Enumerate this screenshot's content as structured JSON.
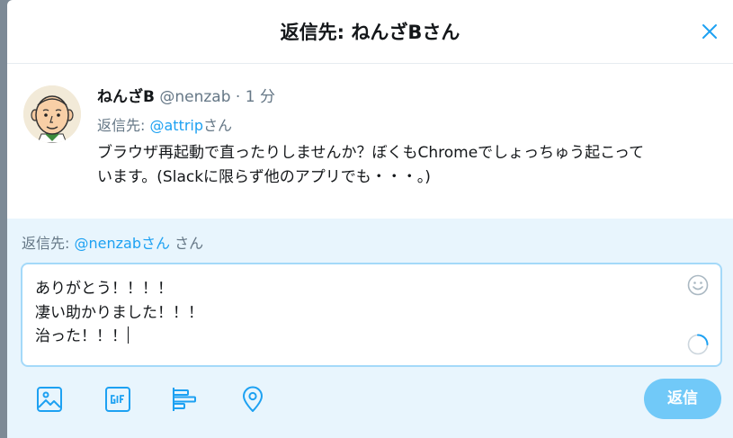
{
  "dialog": {
    "title": "返信先: ねんざBさん"
  },
  "tweet": {
    "author_name": "ねんざB",
    "author_handle": "@nenzab",
    "separator": "·",
    "time": "1 分",
    "reply_prefix": "返信先: ",
    "reply_mention": "@attrip",
    "reply_suffix": "さん",
    "text_lines": [
      "ブラウザ再起動で直ったりしませんか？ぼくもChromeでしょっちゅう起こって",
      "います。(Slackに限らず他のアプリでも・・・。)"
    ]
  },
  "compose": {
    "reply_prefix": "返信先: ",
    "reply_mention": "@nenzabさん",
    "reply_suffix": " さん",
    "draft_lines": [
      "ありがとう！！！！",
      "凄い助かりました！！！",
      "治った！！！"
    ],
    "submit_label": "返信"
  },
  "icons": {
    "close": "close-icon",
    "emoji": "emoji-icon",
    "progress": "character-count-ring-icon",
    "media": "image-icon",
    "gif": "gif-icon",
    "poll": "poll-icon",
    "location": "location-pin-icon"
  },
  "colors": {
    "accent": "#1da1f2",
    "submit_bg": "#71c9f8",
    "compose_bg": "#e8f5fd",
    "textbox_border": "#a4d9f9",
    "muted_text": "#657786",
    "overlay": "#7d8a96"
  }
}
